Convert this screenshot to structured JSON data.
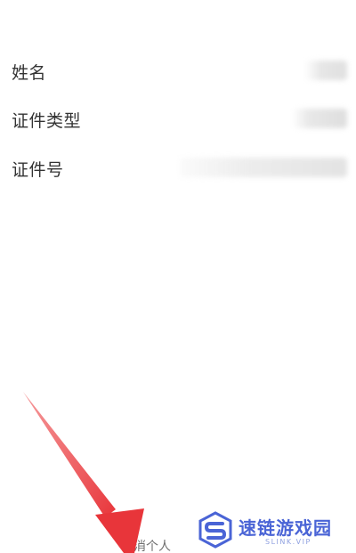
{
  "fields": [
    {
      "label": "姓名"
    },
    {
      "label": "证件类型"
    },
    {
      "label": "证件号"
    }
  ],
  "bottom_link": {
    "label": "取消个人"
  },
  "watermark": {
    "title": "速链游戏园",
    "subtitle": "SLINK.VIP"
  },
  "colors": {
    "arrow": "#e8353a",
    "watermark": "#4a64d6",
    "label": "#333333"
  },
  "icons": {
    "annotation": "red-arrow-icon",
    "watermark_logo": "s-logo-icon"
  }
}
